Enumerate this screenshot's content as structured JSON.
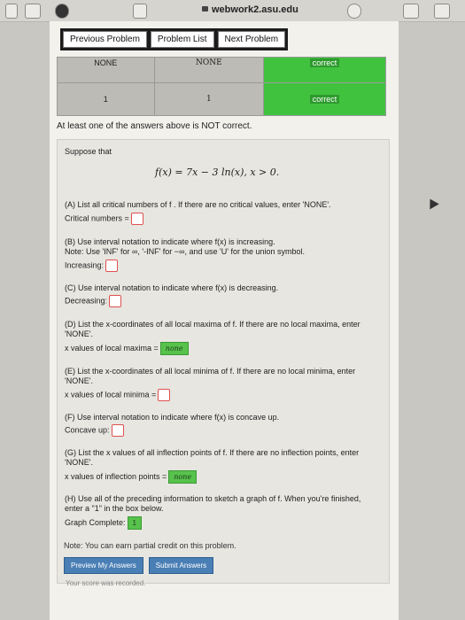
{
  "browser": {
    "url": "webwork2.asu.edu"
  },
  "nav": {
    "previous": "Previous Problem",
    "list": "Problem List",
    "next": "Next Problem"
  },
  "results": {
    "row1": [
      "NONE",
      "NONE",
      "correct"
    ],
    "row2": [
      "1",
      "1",
      "correct"
    ]
  },
  "message": "At least one of the answers above is NOT correct.",
  "problem": {
    "intro": "Suppose that",
    "formula": "f(x) = 7x − 3 ln(x),   x > 0.",
    "a": {
      "q": "(A) List all critical numbers of f . If there are no critical values, enter 'NONE'.",
      "label": "Critical numbers ="
    },
    "b": {
      "q": "(B) Use interval notation to indicate where f(x) is increasing.",
      "note": "Note: Use 'INF' for ∞, '-INF' for −∞, and use 'U' for the union symbol.",
      "label": "Increasing:"
    },
    "c": {
      "q": "(C) Use interval notation to indicate where f(x) is decreasing.",
      "label": "Decreasing:"
    },
    "d": {
      "q": "(D) List the x-coordinates of all local maxima of f. If there are no local maxima, enter",
      "q2": "'NONE'.",
      "label": "x values of local maxima =",
      "value": "none"
    },
    "e": {
      "q": "(E) List the x-coordinates of all local minima of f. If there are no local minima, enter",
      "q2": "'NONE'.",
      "label": "x values of local minima ="
    },
    "f": {
      "q": "(F) Use interval notation to indicate where f(x) is concave up.",
      "label": "Concave up:"
    },
    "g": {
      "q": "(G) List the x values of all inflection points of f. If there are no inflection points, enter",
      "q2": "'NONE'.",
      "label": "x values of inflection points =",
      "value": "none"
    },
    "h": {
      "q": "(H) Use all of the preceding information to sketch a graph of f. When you're finished,",
      "q2": "enter a \"1\" in the box below.",
      "label": "Graph Complete:",
      "value": "1"
    }
  },
  "note": "Note: You can earn partial credit on this problem.",
  "buttons": {
    "preview": "Preview My Answers",
    "submit": "Submit Answers"
  },
  "recorded": "Your score was recorded."
}
